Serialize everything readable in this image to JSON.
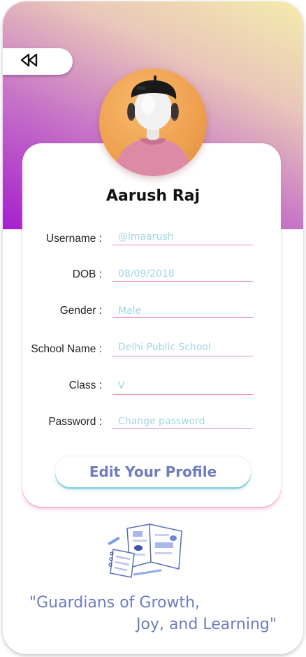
{
  "back": {
    "icon": "rewind-icon"
  },
  "profile": {
    "name": "Aarush Raj",
    "avatar_icon": "student-avatar"
  },
  "fields": [
    {
      "label": "Username :",
      "value": "@imaarush"
    },
    {
      "label": "DOB :",
      "value": "08/09/2018"
    },
    {
      "label": "Gender :",
      "value": "Male"
    },
    {
      "label": "School Name :",
      "value": "Delhi Public School"
    },
    {
      "label": "Class :",
      "value": "V"
    },
    {
      "label": "Password :",
      "value": "Change  password"
    }
  ],
  "edit_button": {
    "label": "Edit Your Profile"
  },
  "quote": {
    "line1": "\"Guardians of Growth,",
    "line2": "Joy, and Learning\""
  },
  "illustration_icon": "open-book-notebook-icon",
  "colors": {
    "gradient_start": "#a51fcf",
    "gradient_end": "#f4ebad",
    "value_text": "#9fd6e4",
    "field_line": "#e889b9",
    "button_text": "#6e7bbf",
    "quote_text": "#6f7cbf"
  }
}
